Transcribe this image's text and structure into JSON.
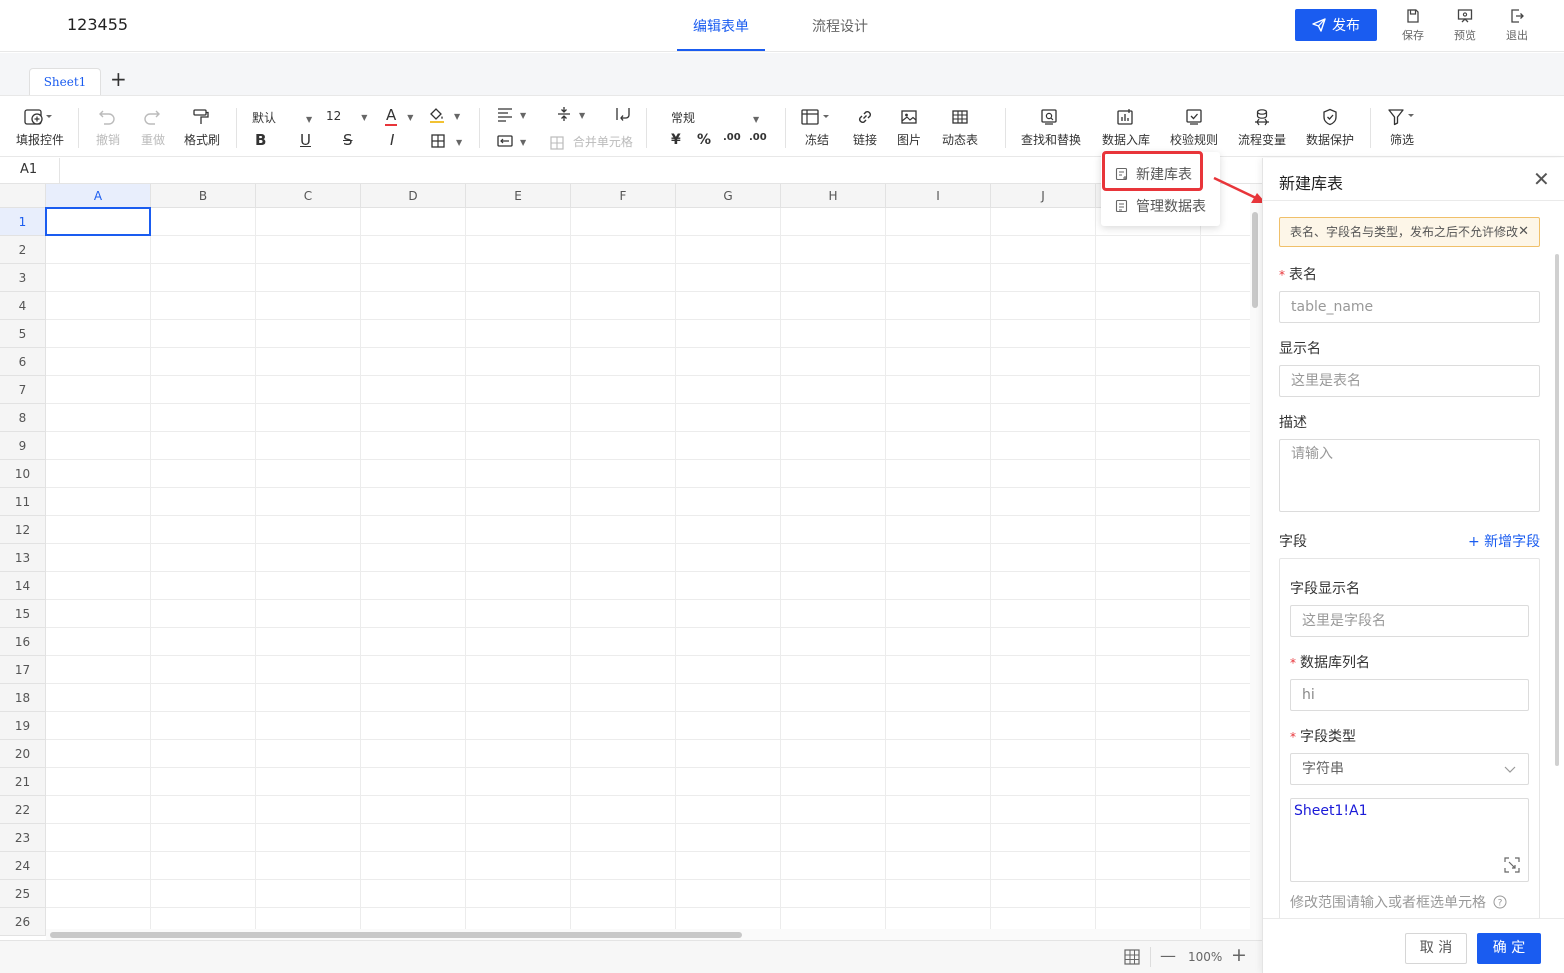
{
  "header": {
    "app_title": "123455",
    "tabs": [
      {
        "label": "编辑表单"
      },
      {
        "label": "流程设计"
      }
    ],
    "publish_label": "发布",
    "actions": [
      {
        "label": "保存"
      },
      {
        "label": "预览"
      },
      {
        "label": "退出"
      }
    ]
  },
  "sheets": {
    "tabs": [
      {
        "label": "Sheet1"
      }
    ],
    "add_label": "+"
  },
  "toolbar": {
    "fill_control": "填报控件",
    "undo": "撤销",
    "redo": "重做",
    "format_painter": "格式刷",
    "font_name": "默认",
    "font_size": "12",
    "bold": "B",
    "underline": "U",
    "strike": "S",
    "italic": "I",
    "merge_cells": "合并单元格",
    "number_format": "常规",
    "currency": "¥",
    "percent": "%",
    "dec_add": ".00",
    "dec_remove": ".00",
    "freeze": "冻结",
    "link": "链接",
    "image": "图片",
    "dynamic_table": "动态表",
    "find_replace": "查找和替换",
    "data_store": "数据入库",
    "validation": "校验规则",
    "flow_var": "流程变量",
    "data_protect": "数据保护",
    "filter": "筛选"
  },
  "formula_bar": {
    "cell_ref": "A1"
  },
  "grid": {
    "columns": [
      "A",
      "B",
      "C",
      "D",
      "E",
      "F",
      "G",
      "H",
      "I",
      "J"
    ],
    "rows": [
      "1",
      "2",
      "3",
      "4",
      "5",
      "6",
      "7",
      "8",
      "9",
      "10",
      "11",
      "12",
      "13",
      "14",
      "15",
      "16",
      "17",
      "18",
      "19",
      "20",
      "21",
      "22",
      "23",
      "24",
      "25",
      "26"
    ],
    "selected_cell": "A1"
  },
  "status_bar": {
    "zoom": "100%"
  },
  "dropdown": {
    "items": [
      {
        "label": "新建库表"
      },
      {
        "label": "管理数据表"
      }
    ]
  },
  "panel": {
    "title": "新建库表",
    "warning": "表名、字段名与类型，发布之后不允许修改",
    "table_name": {
      "label": "表名",
      "placeholder": "table_name"
    },
    "display_name": {
      "label": "显示名",
      "placeholder": "这里是表名"
    },
    "description": {
      "label": "描述",
      "placeholder": "请输入"
    },
    "fields": {
      "label": "字段",
      "add_label": "+ 新增字段",
      "field_display_name": {
        "label": "字段显示名",
        "placeholder": "这里是字段名"
      },
      "db_column": {
        "label": "数据库列名",
        "value": "hi"
      },
      "field_type": {
        "label": "字段类型",
        "value": "字符串"
      },
      "range_value": "Sheet1!A1",
      "range_hint": "修改范围请输入或者框选单元格"
    },
    "cancel_label": "取 消",
    "ok_label": "确 定"
  },
  "colors": {
    "accent": "#1a5cf0",
    "highlight": "#e8353a",
    "warning_bg": "#fdf6e8",
    "warning_border": "#f0c06a"
  }
}
